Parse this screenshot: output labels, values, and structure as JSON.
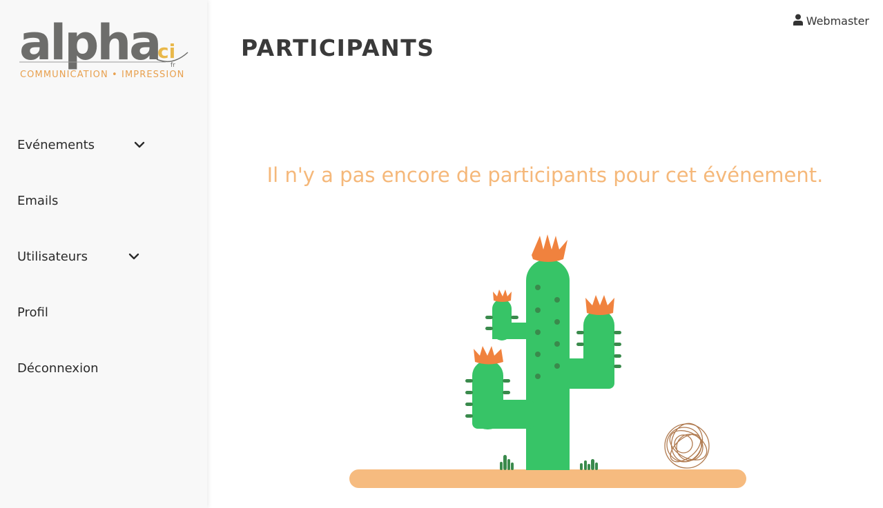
{
  "brand": {
    "logo_word": "alpha",
    "logo_badge": "ci",
    "logo_tld": "fr",
    "tagline": "COMMUNICATION • IMPRESSION"
  },
  "sidebar": {
    "items": [
      {
        "label": "Evénements",
        "has_submenu": true
      },
      {
        "label": "Emails",
        "has_submenu": false
      },
      {
        "label": "Utilisateurs",
        "has_submenu": true
      },
      {
        "label": "Profil",
        "has_submenu": false
      },
      {
        "label": "Déconnexion",
        "has_submenu": false
      }
    ]
  },
  "header": {
    "title": "PARTICIPANTS",
    "user_name": "Webmaster",
    "user_icon": "user-icon"
  },
  "main": {
    "empty_message": "Il n'y a pas encore de participants pour cet événement."
  },
  "colors": {
    "accent_orange": "#f5b87a",
    "cactus_green": "#37c467",
    "cactus_dark": "#3a8a4c",
    "flower_orange": "#f0823e",
    "ground": "#f6bb7f",
    "logo_gray": "#6d6d6b"
  }
}
